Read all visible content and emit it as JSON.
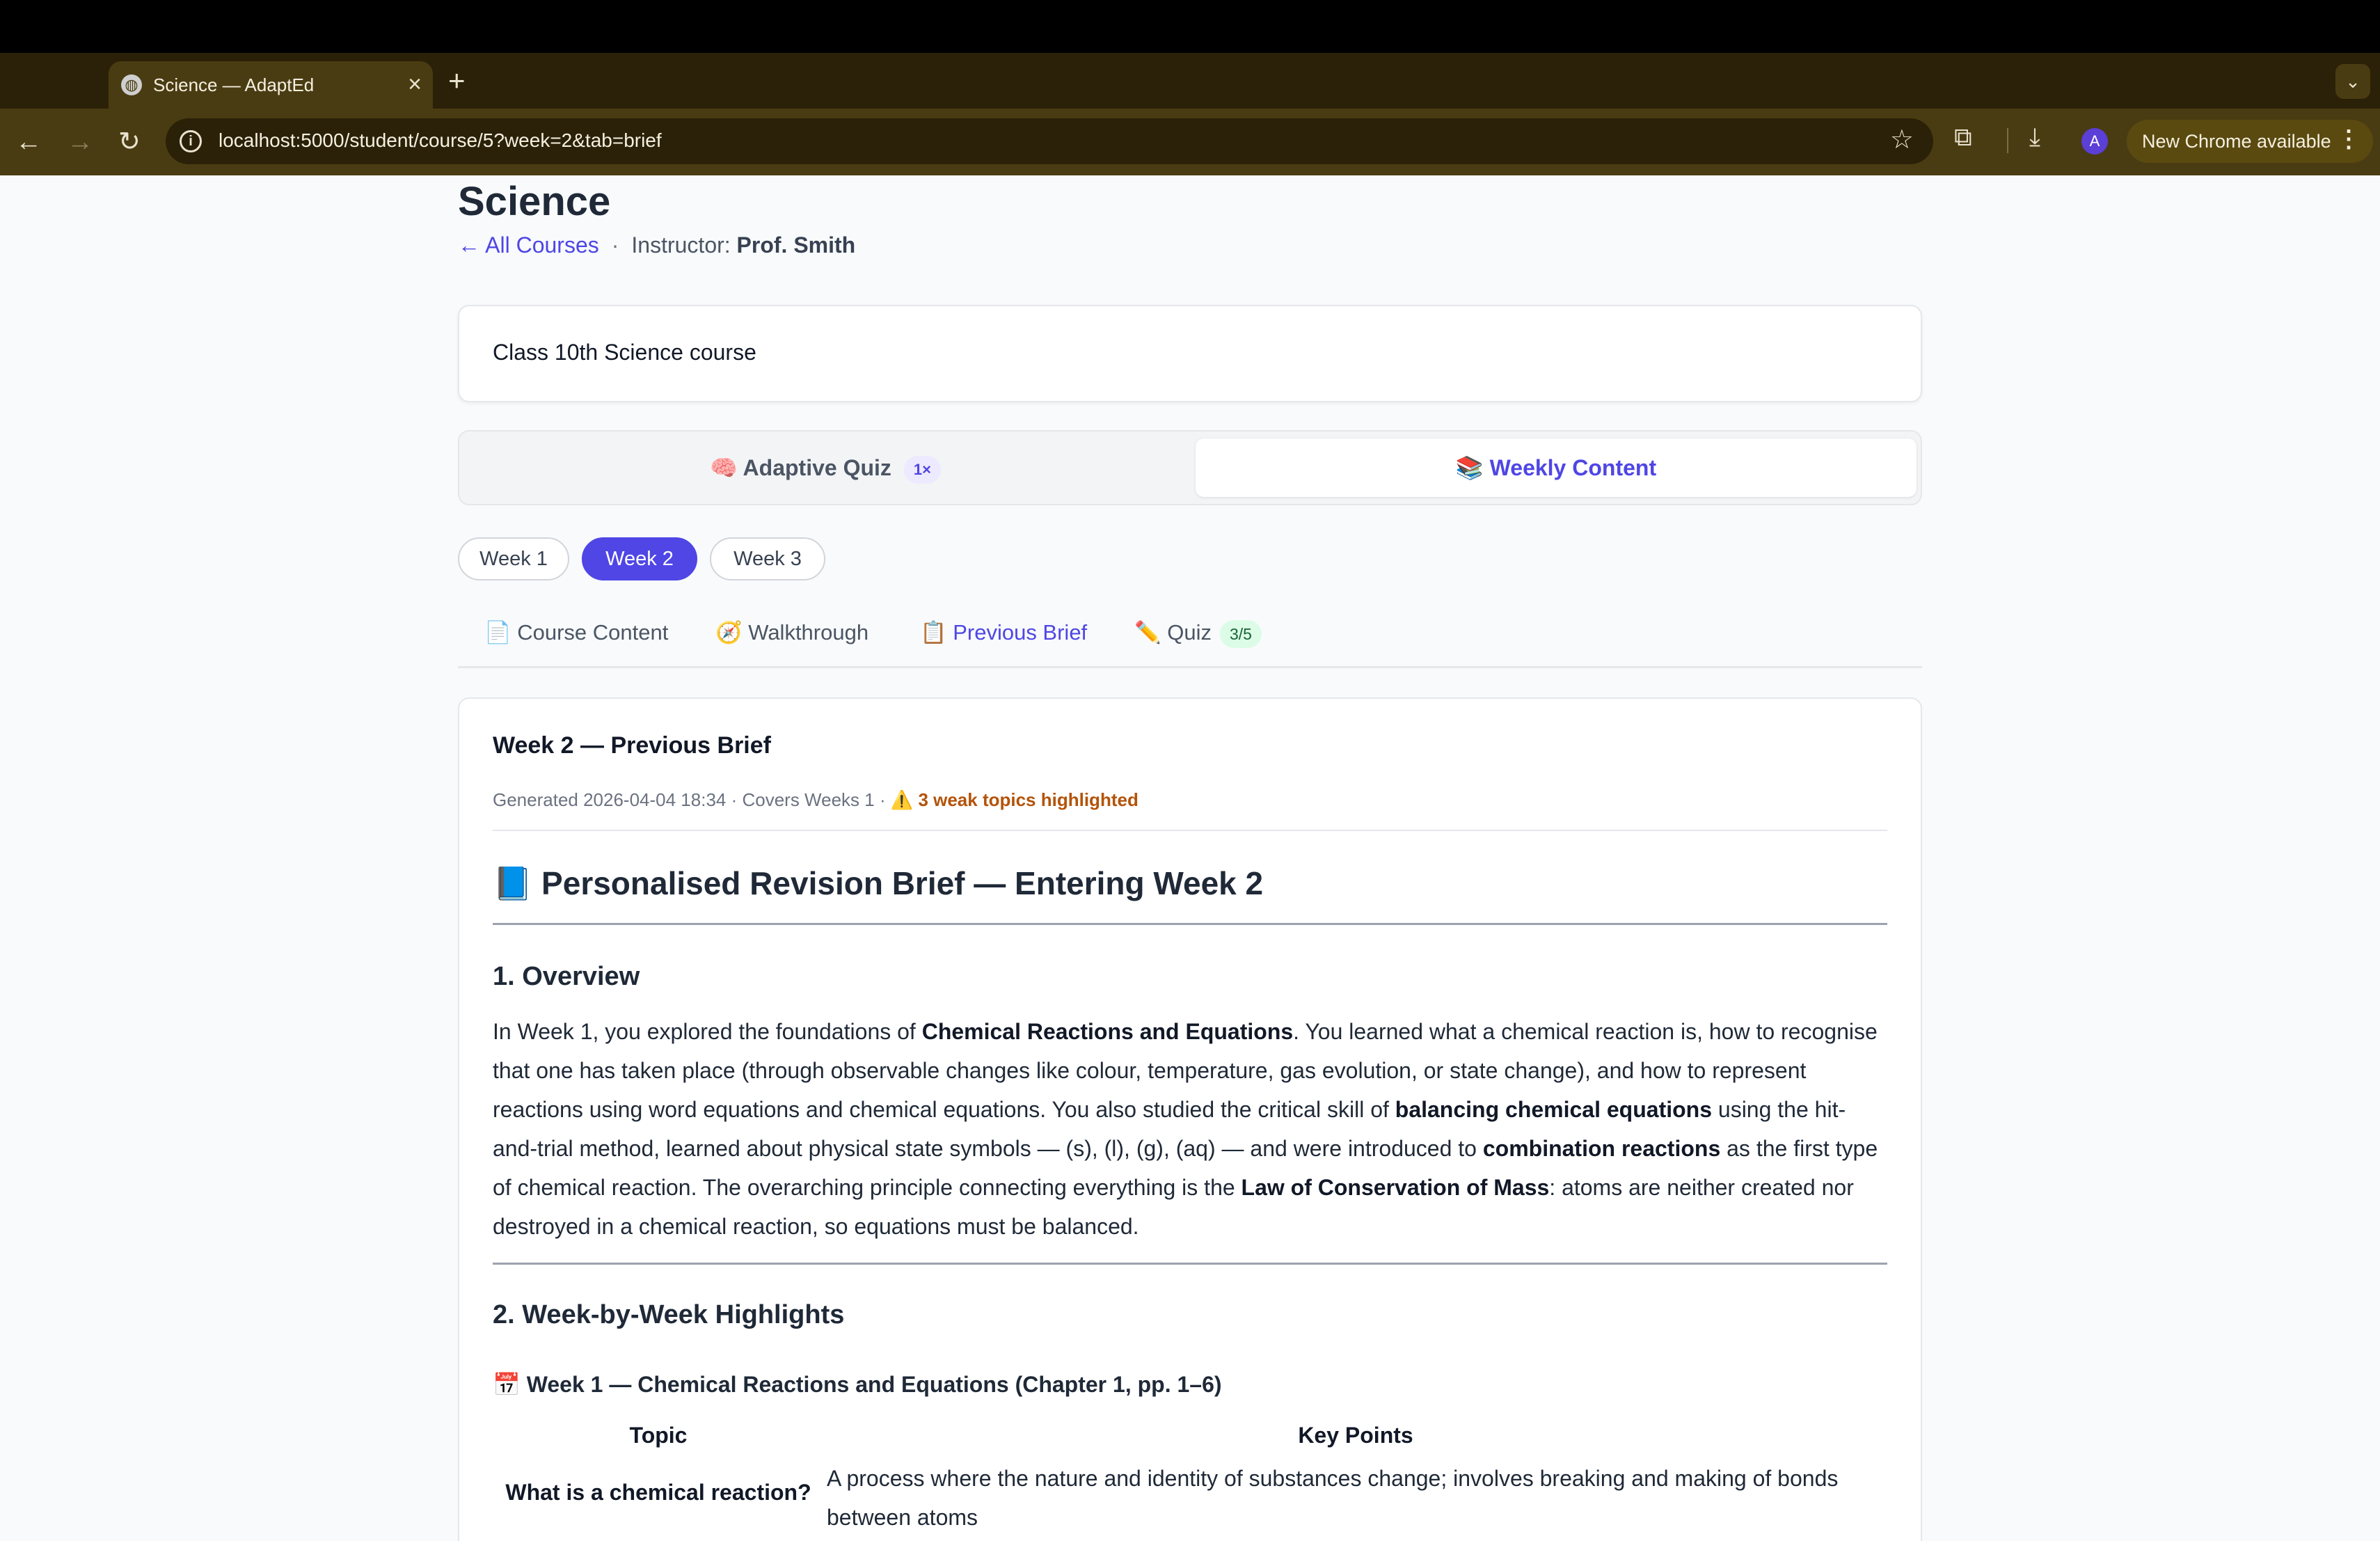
{
  "browser": {
    "tab_title": "Science — AdaptEd",
    "tab_close": "×",
    "new_tab": "+",
    "tabs_menu": "⌄",
    "url": "localhost:5000/student/course/5?week=2&tab=brief",
    "profile_initial": "A",
    "update_label": "New Chrome available",
    "kebab": "⋮",
    "nav": {
      "back": "←",
      "forward": "→",
      "reload": "↻"
    }
  },
  "course": {
    "title": "Science",
    "back_link": "← All Courses",
    "separator": "·",
    "instructor_label": "Instructor:",
    "instructor_name": "Prof. Smith",
    "description": "Class 10th Science course"
  },
  "mode_toggle": {
    "quiz_label": "🧠 Adaptive Quiz",
    "quiz_badge": "1×",
    "weekly_label": "📚 Weekly Content",
    "selected": "weekly"
  },
  "weeks": [
    "Week 1",
    "Week 2",
    "Week 3"
  ],
  "selected_week": "Week 2",
  "subtabs": {
    "content": "📄 Course Content",
    "walkthrough": "🧭 Walkthrough",
    "brief": "📋 Previous Brief",
    "quiz": "✏️ Quiz",
    "quiz_score": "3/5",
    "active": "brief"
  },
  "brief": {
    "header": "Week 2 — Previous Brief",
    "meta": "Generated 2026-04-04 18:34 · Covers Weeks 1 · ",
    "weak_topics": "⚠️ 3 weak topics highlighted",
    "h1": "📘 Personalised Revision Brief — Entering Week 2",
    "section1_title": "1. Overview",
    "overview": {
      "t1": "In Week 1, you explored the foundations of ",
      "b1": "Chemical Reactions and Equations",
      "t2": ". You learned what a chemical reaction is, how to recognise that one has taken place (through observable changes like colour, temperature, gas evolution, or state change), and how to represent reactions using word equations and chemical equations. You also studied the critical skill of ",
      "b2": "balancing chemical equations",
      "t3": " using the hit-and-trial method, learned about physical state symbols — (s), (l), (g), (aq) — and were introduced to ",
      "b3": "combination reactions",
      "t4": " as the first type of chemical reaction. The overarching principle connecting everything is the ",
      "b4": "Law of Conservation of Mass",
      "t5": ": atoms are neither created nor destroyed in a chemical reaction, so equations must be balanced."
    },
    "section2_title": "2. Week-by-Week Highlights",
    "week1_heading": "📅 Week 1 — Chemical Reactions and Equations (Chapter 1, pp. 1–6)",
    "table": {
      "headers": [
        "Topic",
        "Key Points"
      ],
      "rows": [
        {
          "topic": "What is a chemical reaction?",
          "points": "A process where the nature and identity of substances change; involves breaking and making of bonds between atoms"
        }
      ]
    }
  }
}
